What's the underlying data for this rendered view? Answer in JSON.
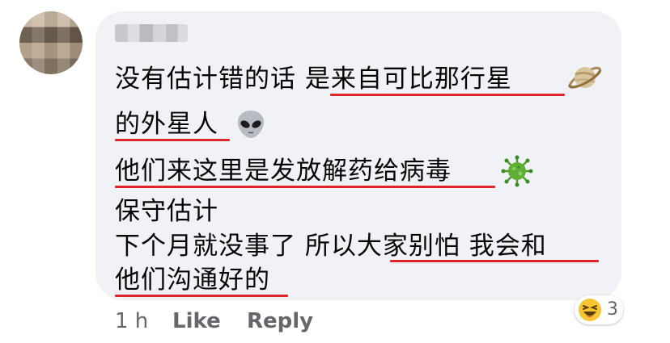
{
  "comment": {
    "lines": [
      "没有估计错的话 是来自可比那行星",
      "的外星人",
      "他们来这里是发放解药给病毒",
      "保守估计",
      "下个月就没事了 所以大家别怕 我会和",
      "他们沟通好的"
    ],
    "emojis": [
      "planet-icon",
      "alien-icon",
      "virus-icon"
    ],
    "underline_color": "#e0252a"
  },
  "actions": {
    "time": "1 h",
    "like": "Like",
    "reply": "Reply"
  },
  "reaction": {
    "icon": "laughing-emoji-icon",
    "count": "3"
  },
  "colors": {
    "bubble": "#f0f2f5",
    "meta_text": "#65676b"
  }
}
